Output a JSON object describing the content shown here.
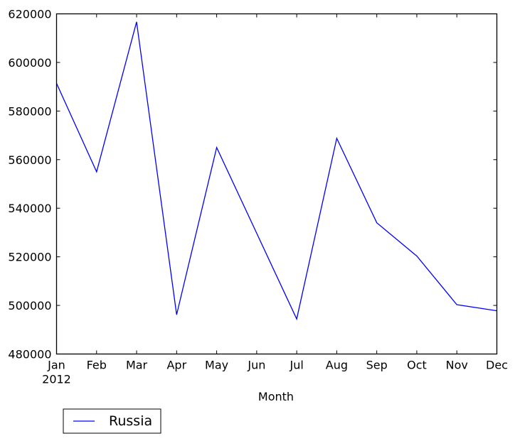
{
  "chart_data": {
    "type": "line",
    "title": "",
    "xlabel": "Month",
    "ylabel": "",
    "categories": [
      "Jan",
      "Feb",
      "Mar",
      "Apr",
      "May",
      "Jun",
      "Jul",
      "Aug",
      "Sep",
      "Oct",
      "Nov",
      "Dec"
    ],
    "x_tick_labels": [
      "Jan",
      "Feb",
      "Mar",
      "Apr",
      "May",
      "Jun",
      "Jul",
      "Aug",
      "Sep",
      "Oct",
      "Nov",
      "Dec"
    ],
    "x_tick_sublabel": "2012",
    "y_ticks": [
      480000,
      500000,
      520000,
      540000,
      560000,
      580000,
      600000,
      620000
    ],
    "ylim": [
      480000,
      620000
    ],
    "grid": false,
    "legend_position": "below-left",
    "series": [
      {
        "name": "Russia",
        "color": "#0000ff",
        "values": [
          591400,
          555000,
          616700,
          496200,
          565000,
          529700,
          494400,
          568800,
          534000,
          520300,
          500300,
          497800
        ]
      }
    ]
  }
}
